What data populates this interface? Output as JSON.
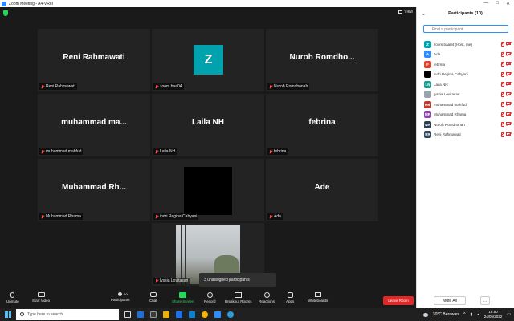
{
  "window": {
    "title": "Zoom Meeting - A4-VRIII",
    "controls": [
      "—",
      "□",
      "✕"
    ]
  },
  "view_button": {
    "label": "View"
  },
  "tiles": [
    {
      "id": "reni",
      "display": "Reni Rahmawati",
      "caption": "Reni Rahmawati"
    },
    {
      "id": "zoom",
      "avatar_letter": "Z",
      "caption": "zoom baa04"
    },
    {
      "id": "nuroh",
      "display": "Nuroh  Romdho...",
      "caption": "Nuroh Romdhonah"
    },
    {
      "id": "mahfud",
      "display": "muhammad  ma...",
      "caption": "muhammad mahfud"
    },
    {
      "id": "laila",
      "display": "Laila NH",
      "caption": "Laila NH"
    },
    {
      "id": "febrina",
      "display": "febrina",
      "caption": "febrina"
    },
    {
      "id": "rhama",
      "display": "Muhammad  Rh...",
      "caption": "Muhammad Rhama"
    },
    {
      "id": "indri",
      "caption": "indri Regina Cahyani"
    },
    {
      "id": "ade",
      "display": "Ade",
      "caption": "Ade"
    },
    {
      "id": "lyssia",
      "caption": "lyssia Lovitasari"
    }
  ],
  "tooltip": {
    "text": "3 unassigned participants"
  },
  "toolbar": {
    "unmute": "Unmute",
    "start_video": "Start Video",
    "participants": "Participants",
    "participants_count": "10",
    "chat": "Chat",
    "share_screen": "Share Screen",
    "record": "Record",
    "breakout": "Breakout Rooms",
    "reactions": "Reactions",
    "apps": "Apps",
    "whiteboards": "Whiteboards",
    "leave": "Leave Room"
  },
  "panel": {
    "title": "Participants (10)",
    "search_placeholder": "Find a participant",
    "participants": [
      {
        "initials": "Z",
        "name": "zoom baa04 (Host, me)",
        "color": "#00a2ad"
      },
      {
        "initials": "A",
        "name": "Ade",
        "color": "#2d8cff"
      },
      {
        "initials": "F",
        "name": "febrina",
        "color": "#e0442f"
      },
      {
        "initials": "",
        "name": "indri Regina Cahyani",
        "color": "#000000"
      },
      {
        "initials": "LN",
        "name": "Laila NH",
        "color": "#1a9e8f"
      },
      {
        "initials": "",
        "name": "lyssia Lovitasari",
        "color": "#9aa3ad"
      },
      {
        "initials": "MM",
        "name": "muhammad mahfud",
        "color": "#c0392b"
      },
      {
        "initials": "MR",
        "name": "Muhammad Rhama",
        "color": "#8e44ad"
      },
      {
        "initials": "NR",
        "name": "Nuroh Romdhonah",
        "color": "#2c3e50"
      },
      {
        "initials": "RR",
        "name": "Reni Rahmawati",
        "color": "#34495e"
      }
    ],
    "mute_all": "Mute All",
    "more": "..."
  },
  "taskbar": {
    "search_placeholder": "Type here to search",
    "weather": "30°C  Berawan",
    "time": "18:50",
    "date": "24/05/2022"
  }
}
